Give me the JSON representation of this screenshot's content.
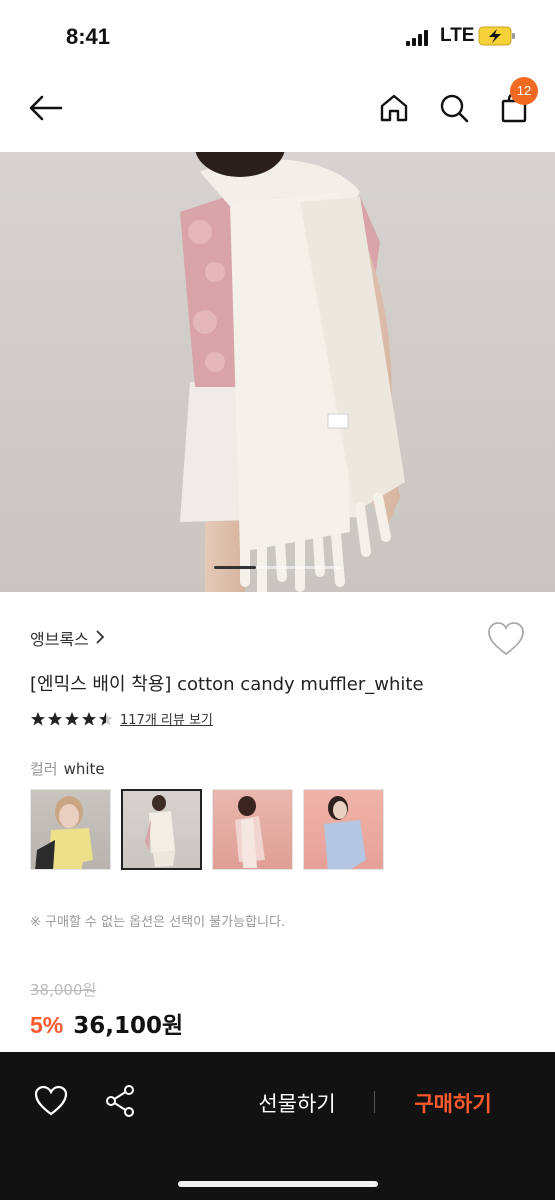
{
  "status_bar": {
    "time": "8:41",
    "network": "LTE"
  },
  "nav": {
    "cart_count": "12"
  },
  "product": {
    "brand": "앵브록스",
    "title": "[엔믹스 배이 착용] cotton candy muffler_white",
    "rating": 4.5,
    "review_link": "117개 리뷰 보기",
    "color_label": "컬러",
    "color_value": "white",
    "swatches": [
      "yellow",
      "white",
      "pink",
      "blue"
    ],
    "selected_swatch": "white",
    "notice": "※ 구매할 수 없는 옵션은 선택이 불가능합니다.",
    "original_price": "38,000원",
    "discount": "5%",
    "sale_price": "36,100원"
  },
  "image_pager": {
    "current": 1,
    "total": 3
  },
  "bottom_bar": {
    "gift_label": "선물하기",
    "buy_label": "구매하기"
  },
  "colors": {
    "accent": "#ff5a2e",
    "badge": "#f26a21",
    "bottom_bar": "#121212"
  }
}
